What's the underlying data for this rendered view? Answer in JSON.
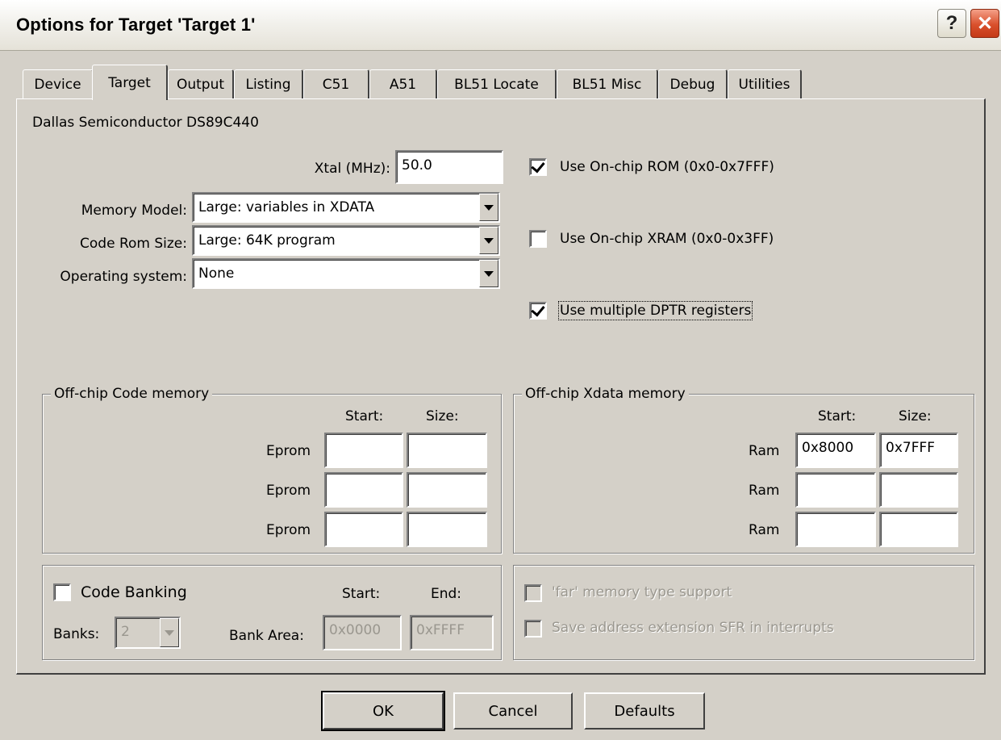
{
  "window": {
    "title": "Options for Target 'Target 1'"
  },
  "tabs": [
    "Device",
    "Target",
    "Output",
    "Listing",
    "C51",
    "A51",
    "BL51 Locate",
    "BL51 Misc",
    "Debug",
    "Utilities"
  ],
  "device_name": "Dallas Semiconductor DS89C440",
  "xtal": {
    "label": "Xtal (MHz):",
    "value": "50.0"
  },
  "memory_model": {
    "label": "Memory Model:",
    "value": "Large: variables in XDATA"
  },
  "code_rom_size": {
    "label": "Code Rom Size:",
    "value": "Large: 64K program"
  },
  "operating_system": {
    "label": "Operating system:",
    "value": "None"
  },
  "options": {
    "onchip_rom": {
      "label": "Use On-chip ROM (0x0-0x7FFF)",
      "checked": true
    },
    "onchip_xram": {
      "label": "Use On-chip XRAM (0x0-0x3FF)",
      "checked": false
    },
    "multiple_dptr": {
      "label": "Use multiple DPTR registers",
      "checked": true
    }
  },
  "code_memory": {
    "title": "Off-chip Code memory",
    "start_header": "Start:",
    "size_header": "Size:",
    "rows": [
      {
        "label": "Eprom",
        "start": "",
        "size": ""
      },
      {
        "label": "Eprom",
        "start": "",
        "size": ""
      },
      {
        "label": "Eprom",
        "start": "",
        "size": ""
      }
    ]
  },
  "xdata_memory": {
    "title": "Off-chip Xdata memory",
    "start_header": "Start:",
    "size_header": "Size:",
    "rows": [
      {
        "label": "Ram",
        "start": "0x8000",
        "size": "0x7FFF"
      },
      {
        "label": "Ram",
        "start": "",
        "size": ""
      },
      {
        "label": "Ram",
        "start": "",
        "size": ""
      }
    ]
  },
  "banking": {
    "label": "Code Banking",
    "checked": false,
    "start_header": "Start:",
    "end_header": "End:",
    "banks_label": "Banks:",
    "banks_value": "2",
    "bank_area_label": "Bank Area:",
    "bank_area_start": "0x0000",
    "bank_area_end": "0xFFFF"
  },
  "far_options": {
    "far_support": "'far' memory type support",
    "save_sfr": "Save address extension SFR in interrupts"
  },
  "buttons": {
    "ok": "OK",
    "cancel": "Cancel",
    "defaults": "Defaults"
  }
}
